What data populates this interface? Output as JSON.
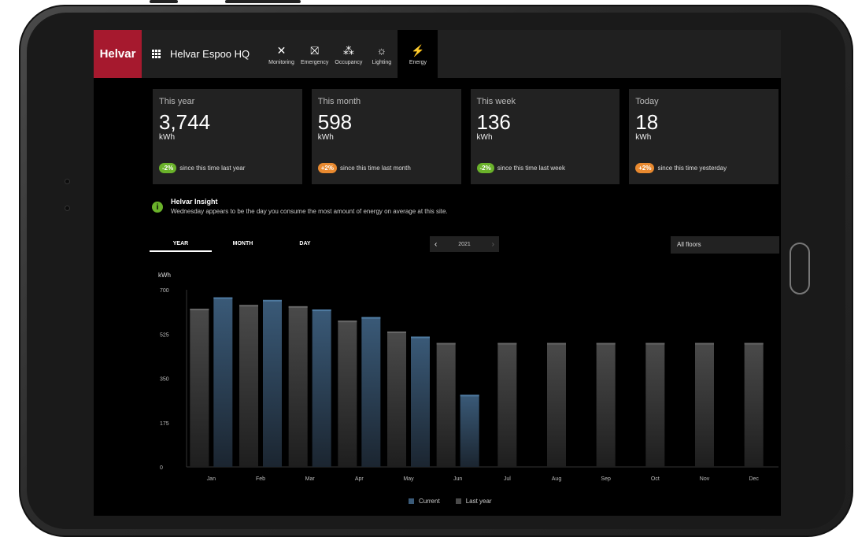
{
  "app": {
    "brand": "Helvar",
    "site_name": "Helvar Espoo HQ"
  },
  "nav": [
    {
      "label": "Monitoring",
      "icon": "tools-icon",
      "glyph": "✕"
    },
    {
      "label": "Emergency",
      "icon": "emergency-exit-icon",
      "glyph": "⛝"
    },
    {
      "label": "Occupancy",
      "icon": "people-icon",
      "glyph": "⁂"
    },
    {
      "label": "Lighting",
      "icon": "light-icon",
      "glyph": "☼"
    },
    {
      "label": "Energy",
      "icon": "lightning-icon",
      "glyph": "⚡",
      "active": true
    }
  ],
  "kpis": [
    {
      "title": "This year",
      "value": "3,744",
      "unit": "kWh",
      "delta": "-2%",
      "delta_color": "#6ab22a",
      "delta_text": "since this time last year"
    },
    {
      "title": "This month",
      "value": "598",
      "unit": "kWh",
      "delta": "+2%",
      "delta_color": "#e8892f",
      "delta_text": "since this time last month"
    },
    {
      "title": "This week",
      "value": "136",
      "unit": "kWh",
      "delta": "-2%",
      "delta_color": "#6ab22a",
      "delta_text": "since this time last week"
    },
    {
      "title": "Today",
      "value": "18",
      "unit": "kWh",
      "delta": "+2%",
      "delta_color": "#e8892f",
      "delta_text": "since this time yesterday"
    }
  ],
  "insight": {
    "title": "Helvar Insight",
    "text": "Wednesday appears to be the day you consume the most amount of energy on average at this site."
  },
  "controls": {
    "tabs": [
      "YEAR",
      "MONTH",
      "DAY"
    ],
    "year": "2021",
    "floor": "All floors"
  },
  "colors": {
    "current": "#3a5a78",
    "last_year": "#4a4a4a",
    "brand": "#a6192e"
  },
  "chart_data": {
    "type": "bar",
    "ylabel": "kWh",
    "ylim": [
      0,
      700
    ],
    "yticks": [
      0,
      175,
      350,
      525,
      700
    ],
    "categories": [
      "Jan",
      "Feb",
      "Mar",
      "Apr",
      "May",
      "Jun",
      "Jul",
      "Aug",
      "Sep",
      "Oct",
      "Nov",
      "Dec"
    ],
    "series": [
      {
        "name": "Last year",
        "values": [
          625,
          640,
          635,
          578,
          535,
          490,
          490,
          490,
          490,
          490,
          490,
          490
        ]
      },
      {
        "name": "Current",
        "values": [
          670,
          660,
          622,
          592,
          515,
          285,
          null,
          null,
          null,
          null,
          null,
          null
        ]
      }
    ],
    "legend": [
      "Current",
      "Last year"
    ],
    "grid": false
  }
}
